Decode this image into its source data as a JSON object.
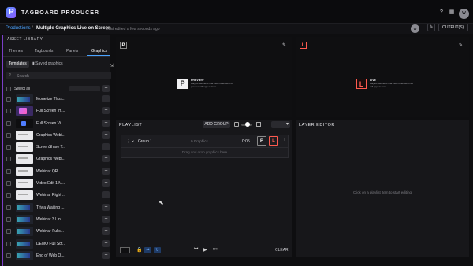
{
  "app": {
    "title": "TAGBOARD PRODUCER",
    "user_initials": "W"
  },
  "topbar": {
    "help_icon": "help-circle-icon",
    "apps_icon": "grid-icon"
  },
  "breadcrumb": {
    "link": "Productions",
    "separator": "/",
    "current": "Multiple Graphics Live on Screen",
    "last_edited": "Last edited a few seconds ago",
    "collaborator_initials": "W",
    "output_label": "OUTPUT(S)"
  },
  "library": {
    "title": "ASSET LIBRARY",
    "tabs": [
      "Themes",
      "Tagboards",
      "Panels",
      "Graphics"
    ],
    "active_tab": "Graphics",
    "subtabs": [
      "Templates",
      "Saved graphics"
    ],
    "active_subtab": "Templates",
    "search_placeholder": "Search",
    "select_all": "Select all",
    "assets": [
      {
        "name": "Monetize Thos...",
        "thumb": "dark"
      },
      {
        "name": "Full Screen Im...",
        "thumb": "purple"
      },
      {
        "name": "Full Screen Vi...",
        "thumb": "logo-thumb"
      },
      {
        "name": "Graphics Webi...",
        "thumb": "white"
      },
      {
        "name": "ScreenShare T...",
        "thumb": "white"
      },
      {
        "name": "Graphics Webi...",
        "thumb": "white"
      },
      {
        "name": "Webinar QR",
        "thumb": "white"
      },
      {
        "name": "Video Edit 1 N...",
        "thumb": "white"
      },
      {
        "name": "Webinar Right ...",
        "thumb": "white"
      },
      {
        "name": "Trivia Waiting ...",
        "thumb": "dark"
      },
      {
        "name": "Webinar 3 Lin...",
        "thumb": "dark"
      },
      {
        "name": "Webinar-Fulls...",
        "thumb": "dark"
      },
      {
        "name": "DEMO Full Scr...",
        "thumb": "dark"
      },
      {
        "name": "End of Web Q...",
        "thumb": "dark"
      }
    ]
  },
  "preview_pane": {
    "badge": "P",
    "label": "PREVIEW",
    "description": "Playlist elements that have been sent to preview will appear here"
  },
  "live_pane": {
    "badge": "L",
    "label": "LIVE",
    "description": "Playlist elements that have been sent live will appear here"
  },
  "playlist": {
    "title": "PLAYLIST",
    "add_group": "ADD GROUP",
    "group": {
      "name": "Group 1",
      "count": "0 Graphics",
      "duration": "0:05",
      "preview_btn": "P",
      "live_btn": "L",
      "drop_hint": "Drag and drop graphics here"
    },
    "clear": "CLEAR"
  },
  "layer_editor": {
    "title": "LAYER EDITOR",
    "empty_hint": "Click on a playlist item to start editing"
  },
  "colors": {
    "accent": "#4aa3ff",
    "live": "#ff5a4f",
    "sidebar_accent": "#7b3fc8"
  }
}
